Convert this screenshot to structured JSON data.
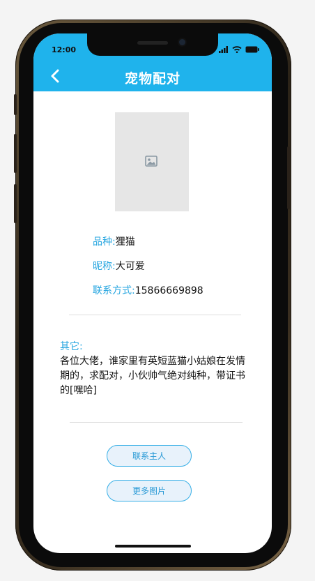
{
  "status": {
    "time": "12:00"
  },
  "nav": {
    "title": "宠物配对"
  },
  "photo": {
    "icon": "image-placeholder-icon"
  },
  "pet": {
    "breed_label": "品种:",
    "breed_value": "狸猫",
    "name_label": "昵称:",
    "name_value": "大可爱",
    "contact_label": "联系方式:",
    "contact_value": "15866669898"
  },
  "other": {
    "label": "其它:",
    "text": "各位大佬，谁家里有英短蓝猫小姑娘在发情期的，求配对，小伙帅气绝对纯种，带证书的[嘿哈]"
  },
  "actions": {
    "contact_owner": "联系主人",
    "more_photos": "更多图片"
  },
  "colors": {
    "accent": "#1fb3ec",
    "label": "#27a6e0"
  }
}
